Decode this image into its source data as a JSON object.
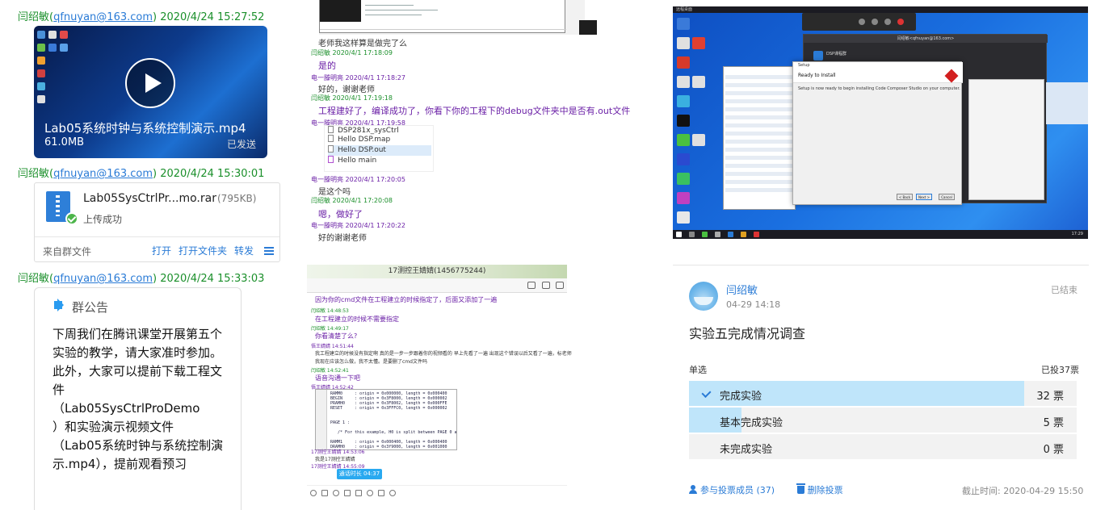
{
  "left": {
    "msg1": {
      "sender": "闫绍敏",
      "email": "qfnuyan@163.com",
      "time": "2020/4/24 15:27:52"
    },
    "video": {
      "title": "Lab05系统时钟与系统控制演示.mp4",
      "size": "61.0MB",
      "status": "已发送"
    },
    "msg2": {
      "sender": "闫绍敏",
      "email": "qfnuyan@163.com",
      "time": "2020/4/24 15:30:01"
    },
    "file": {
      "name": "Lab05SysCtrlPr...mo.rar",
      "size": "(795KB)",
      "status": "上传成功",
      "from": "来自群文件",
      "open": "打开",
      "open_folder": "打开文件夹",
      "forward": "转发"
    },
    "msg3": {
      "sender": "闫绍敏",
      "email": "qfnuyan@163.com",
      "time": "2020/4/24 15:33:03"
    },
    "announcement": {
      "title": "群公告",
      "line1": "下周我们在腾讯课堂开展第五个实验的教学，请大家准时参加。",
      "line2": "此外，大家可以提前下载工程文件",
      "line3": "（Lab05SysCtrlProDemo",
      "line4": "）和实验演示视频文件",
      "line5": "（Lab05系统时钟与系统控制演示.mp4），提前观看预习"
    }
  },
  "chat1": {
    "m1": "老师我这样算是做完了么",
    "n1": "闫绍敏 2020/4/1 17:18:09",
    "m2": "是的",
    "n2": "电一滕明亮 2020/4/1 17:18:27",
    "m3": "好的，谢谢老师",
    "n3": "闫绍敏 2020/4/1 17:19:18",
    "m4": "工程建好了，编译成功了，你看下你的工程下的debug文件夹中是否有.out文件",
    "n4": "电一滕明亮 2020/4/1 17:19:58",
    "files": [
      "DSP281x_sysCtrl",
      "Hello DSP.map",
      "Hello DSP.out",
      "Hello main"
    ],
    "n5": "电一滕明亮 2020/4/1 17:20:05",
    "m5": "是这个吗",
    "n6": "闫绍敏 2020/4/1 17:20:08",
    "m6": "嗯，做好了",
    "n7": "电一滕明亮 2020/4/1 17:20:22",
    "m7": "好的谢谢老师"
  },
  "chat2": {
    "title": "17测控王婧婧(1456775244)",
    "m1": "因为你的cmd文件在工程建立的时候指定了，后面又添加了一遍",
    "n1": "闫绍敏 14:48:53",
    "m2": "在工程建立的时候不需要指定",
    "n2": "闫绍敏 14:49:17",
    "m3": "你看清楚了么?",
    "n3": "悟王婧婧 14:51:44",
    "m4a": "我工程建立的时候没有指定啊 真的是一步一步跟着你的视频看的 早上先看了一遍 出现这个错误以后又看了一遍，标老师",
    "m4b": "我现在应该怎么做，我不太懂。是要删了cmd文件吗",
    "n4": "闫绍敏 14:52:41",
    "m5": "语音沟通一下吧",
    "n5": "悟王婧婧 14:52:42",
    "code": "RAMM0     : origin = 0x000000, length = 0x000400\nBEGIN     : origin = 0x3F8000, length = 0x000002\nPRAMH0    : origin = 0x3F8002, length = 0x000FFE\nRESET     : origin = 0x3FFFC0, length = 0x000002\n\n\nPAGE 1 :\n\n   /* For this example, H0 is split between PAGE 0 and PAGE 1 */\n\nRAMM1     : origin = 0x000400, length = 0x000400\nDRAMH0    : origin = 0x3f9000, length = 0x001000",
    "n6": "17测控王婧婧 14:53:06",
    "m6": "我是17测控王婧婧",
    "n7": "17测控王婧婧 14:55:09",
    "call": "通话时长 04:37"
  },
  "desktop": {
    "title": "远程桌面",
    "remote_window": "闫绍敏<qfnuyan@163.com>",
    "app_window": "DSP课程群",
    "setup_heading": "Ready to Install",
    "setup_text": "Setup is now ready to begin installing Code Composer Studio on your computer.",
    "back": "< Back",
    "next": "Next >",
    "cancel": "Cancel",
    "clock": "17:29"
  },
  "poll": {
    "author": "闫绍敏",
    "date": "04-29 14:18",
    "state": "已结束",
    "title": "实验五完成情况调查",
    "type": "单选",
    "total": "已投37票",
    "options": [
      {
        "label": "完成实验",
        "votes": "32 票",
        "fraction": 0.865,
        "checked": true
      },
      {
        "label": "基本完成实验",
        "votes": "5 票",
        "fraction": 0.135,
        "checked": false
      },
      {
        "label": "未完成实验",
        "votes": "0 票",
        "fraction": 0,
        "checked": false
      }
    ],
    "members": "参与投票成员 (37)",
    "delete": "删除投票",
    "deadline": "截止时间: 2020-04-29 15:50"
  }
}
